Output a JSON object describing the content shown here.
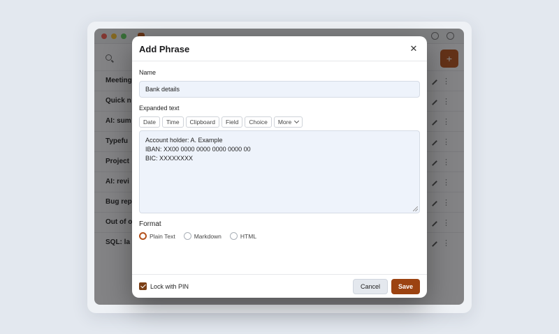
{
  "app": {
    "background_rows": [
      {
        "label": "Meeting"
      },
      {
        "label": "Quick n"
      },
      {
        "label": "AI: sum"
      },
      {
        "label": "Typefu"
      },
      {
        "label": "Project"
      },
      {
        "label": "AI: revi"
      },
      {
        "label": "Bug rep"
      },
      {
        "label": "Out of o"
      },
      {
        "label": "SQL: la"
      }
    ],
    "add_label": "+"
  },
  "modal": {
    "title": "Add Phrase",
    "close_glyph": "✕",
    "name_label": "Name",
    "name_value": "Bank details",
    "expanded_label": "Expanded text",
    "chips": [
      "Date",
      "Time",
      "Clipboard",
      "Field",
      "Choice"
    ],
    "more_chip": "More",
    "expanded_lines": [
      "Account holder: A. Example",
      "IBAN: XX00 0000 0000 0000 0000 00",
      "BIC: XXXXXXXX"
    ],
    "format_label": "Format",
    "format_options": [
      "Plain Text",
      "Markdown",
      "HTML"
    ],
    "format_selected": "Plain Text",
    "lock_label": "Lock with PIN",
    "lock_checked": true,
    "cancel_label": "Cancel",
    "save_label": "Save"
  },
  "colors": {
    "accent": "#9c4311",
    "checkbox": "#7b3f16",
    "input_bg": "#eef3fb"
  }
}
